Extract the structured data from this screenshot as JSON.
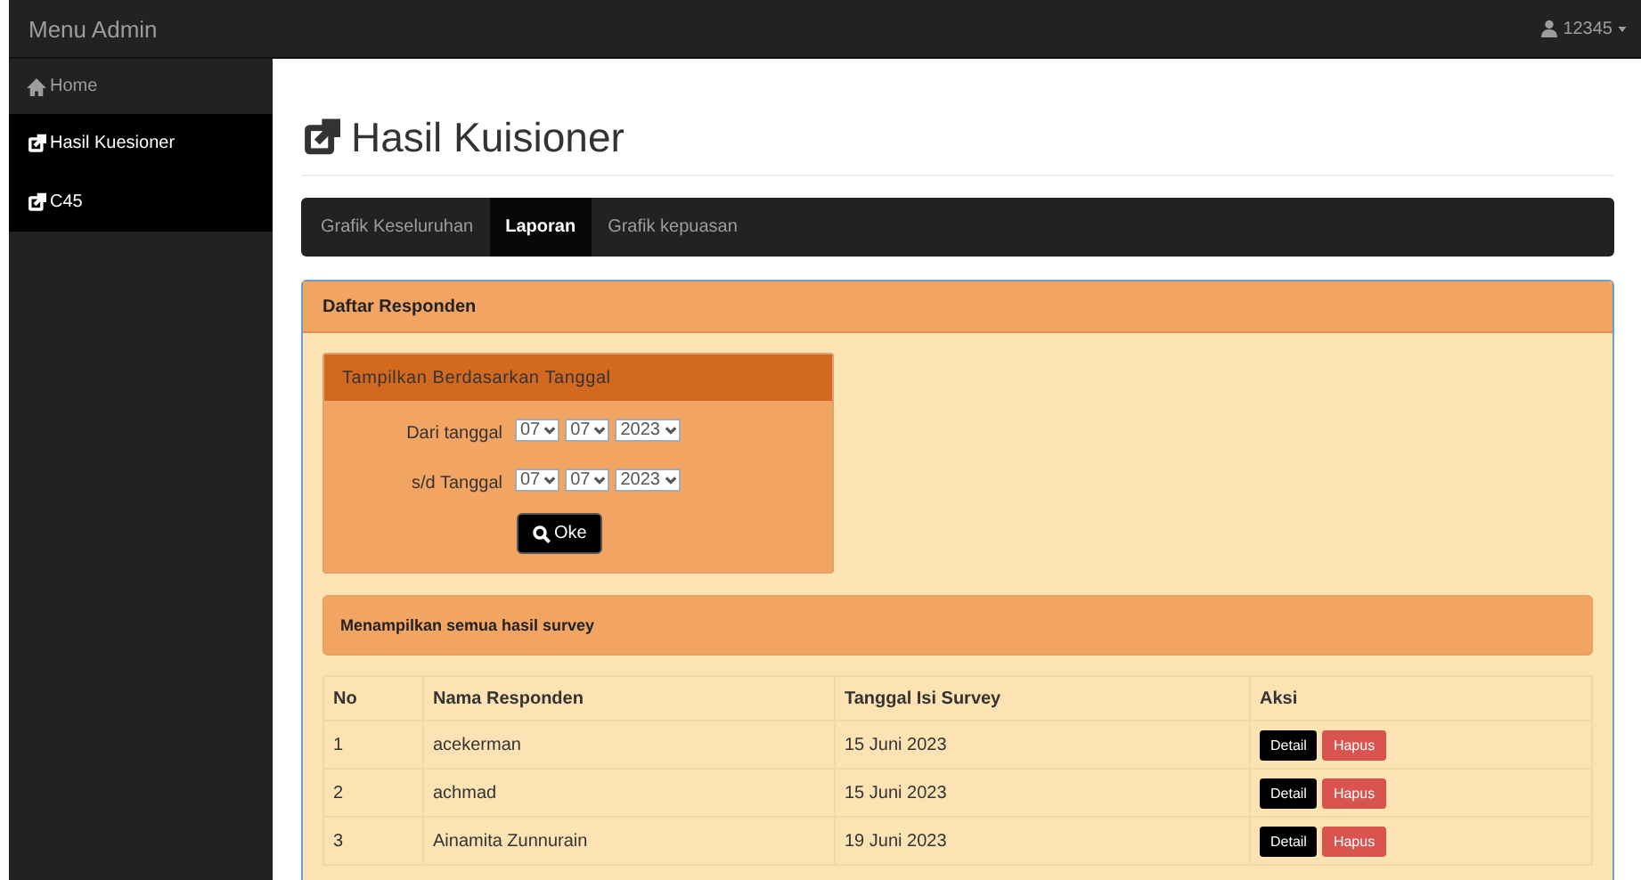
{
  "topbar": {
    "brand": "Menu Admin",
    "user": "12345"
  },
  "sidebar": {
    "items": [
      {
        "label": "Home",
        "kind": "home",
        "selected": false
      },
      {
        "label": "Hasil Kuesioner",
        "kind": "link",
        "selected": true
      },
      {
        "label": "C45",
        "kind": "link",
        "selected": true
      }
    ]
  },
  "page_title": "Hasil Kuisioner",
  "tabs": [
    {
      "label": "Grafik Keseluruhan",
      "selected": false
    },
    {
      "label": "Laporan",
      "selected": true
    },
    {
      "label": "Grafik kepuasan",
      "selected": false
    }
  ],
  "panel": {
    "title": "Daftar Responden",
    "filter": {
      "title": "Tampilkan Berdasarkan Tanggal",
      "rows": [
        {
          "label": "Dari tanggal",
          "selects": [
            "07",
            "07",
            "2023"
          ]
        },
        {
          "label": "s/d Tanggal",
          "selects": [
            "07",
            "07",
            "2023"
          ]
        }
      ],
      "button": "Oke"
    },
    "alert": "Menampilkan semua hasil survey",
    "table": {
      "columns": [
        "No",
        "Nama Responden",
        "Tanggal Isi Survey",
        "Aksi"
      ],
      "rows": [
        {
          "cells": [
            "1",
            "acekerman",
            "15 Juni 2023"
          ],
          "actions": [
            "Detail",
            "Hapus"
          ]
        },
        {
          "cells": [
            "2",
            "achmad",
            "15 Juni 2023"
          ],
          "actions": [
            "Detail",
            "Hapus"
          ]
        },
        {
          "cells": [
            "3",
            "Ainamita Zunnurain",
            "19 Juni 2023"
          ],
          "actions": [
            "Detail",
            "Hapus"
          ]
        }
      ]
    }
  }
}
